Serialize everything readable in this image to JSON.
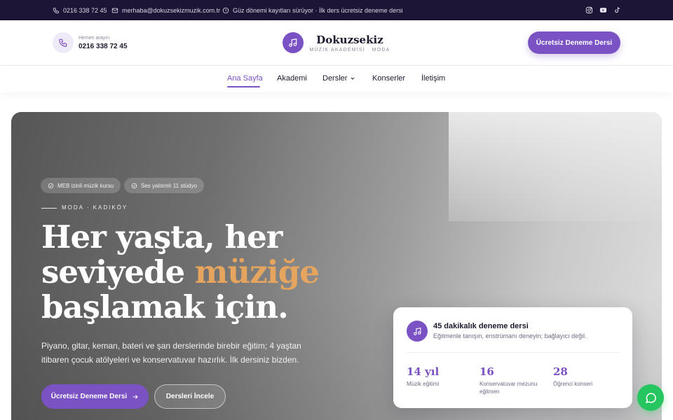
{
  "topbar": {
    "phone": "0216 338 72 45",
    "email": "merhaba@dokuzsekizmuzik.com.tr",
    "notice": "Güz dönemi kayıtları sürüyor · İlk ders ücretsiz deneme dersi",
    "social": [
      "instagram-icon",
      "youtube-icon",
      "tiktok-icon"
    ]
  },
  "header": {
    "call_label": "Hemen arayın",
    "call_number": "0216 338 72 45",
    "logo_name": "Dokuzsekiz",
    "logo_sub": "MÜZİK AKADEMİSİ · MODA",
    "cta": "Ücretsiz Deneme Dersi"
  },
  "nav": {
    "items": [
      {
        "label": "Ana Sayfa",
        "active": true
      },
      {
        "label": "Akademi"
      },
      {
        "label": "Dersler",
        "dropdown": true
      },
      {
        "label": "Konserler"
      },
      {
        "label": "İletişim"
      }
    ]
  },
  "hero": {
    "chips": [
      "MEB izinli müzik kursu",
      "Ses yalıtımlı 11 stüdyo"
    ],
    "eyebrow": "MODA · KADIKÖY",
    "headline_line1": "Her yaşta, her",
    "headline_line2_pre": "seviyede ",
    "headline_accent": "müziğe",
    "headline_line3": "başlamak için.",
    "lead": "Piyano, gitar, keman, bateri ve şan derslerinde birebir eğitim; 4 yaştan itibaren çocuk atölyeleri ve konservatuvar hazırlık. İlk dersiniz bizden.",
    "primary_btn": "Ücretsiz Deneme Dersi",
    "secondary_btn": "Dersleri İncele"
  },
  "trial_card": {
    "title": "45 dakikalık deneme dersi",
    "subtitle": "Eğitmenle tanışın, enstrümanı deneyin; bağlayıcı değil.",
    "stats": [
      {
        "value": "14 yıl",
        "label": "Müzik eğitimi"
      },
      {
        "value": "16",
        "label": "Konservatuvar mezunu eğitmen"
      },
      {
        "value": "28",
        "label": "Öğrenci konseri"
      }
    ]
  },
  "colors": {
    "brand": "#7a52c3",
    "accent": "#e6a55e",
    "topbar": "#1c1535",
    "whatsapp": "#25c560"
  }
}
